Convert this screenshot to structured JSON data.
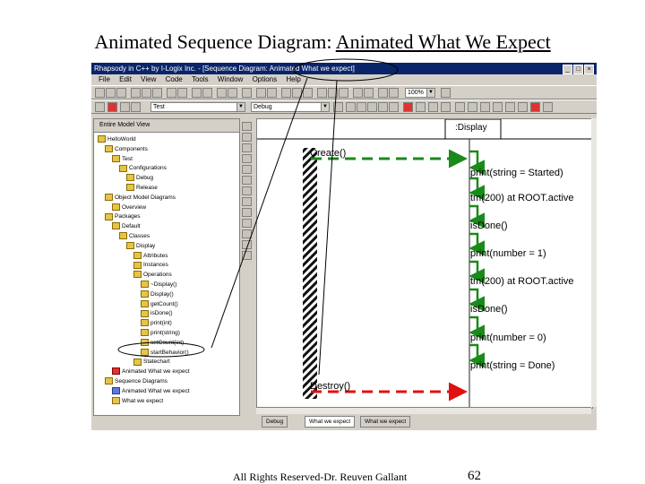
{
  "slide": {
    "title_prefix": "Animated Sequence Diagram: ",
    "title_underlined": "Animated What We Expect",
    "footer": "All Rights Reserved-Dr. Reuven Gallant",
    "page_number": "62"
  },
  "window": {
    "title": "Rhapsody in C++ by I-Logix Inc. - [Sequence Diagram: Animated What we expect]",
    "controls": [
      "_",
      "□",
      "×"
    ]
  },
  "menu": [
    "File",
    "Edit",
    "View",
    "Code",
    "Tools",
    "Window",
    "Options",
    "Help"
  ],
  "toolbar": {
    "zoom_value": "100%",
    "config_value": "Test",
    "mode_value": "Debug"
  },
  "browser": {
    "header": "Entire Model View",
    "items": [
      {
        "label": "HelloWorld",
        "icon": "folder"
      },
      {
        "label": "Components",
        "icon": "folder"
      },
      {
        "label": "Test",
        "icon": "folder"
      },
      {
        "label": "Configurations",
        "icon": "folder"
      },
      {
        "label": "Debug",
        "icon": "item"
      },
      {
        "label": "Release",
        "icon": "item"
      },
      {
        "label": "Object Model Diagrams",
        "icon": "folder"
      },
      {
        "label": "Overview",
        "icon": "item"
      },
      {
        "label": "Packages",
        "icon": "folder"
      },
      {
        "label": "Default",
        "icon": "folder"
      },
      {
        "label": "Classes",
        "icon": "folder"
      },
      {
        "label": "Display",
        "icon": "folder"
      },
      {
        "label": "Attributes",
        "icon": "folder"
      },
      {
        "label": "Instances",
        "icon": "folder"
      },
      {
        "label": "Operations",
        "icon": "folder"
      },
      {
        "label": "~Display()",
        "icon": "item"
      },
      {
        "label": "Display()",
        "icon": "item"
      },
      {
        "label": "getCount()",
        "icon": "item"
      },
      {
        "label": "isDone()",
        "icon": "item"
      },
      {
        "label": "print(int)",
        "icon": "item"
      },
      {
        "label": "print(string)",
        "icon": "item"
      },
      {
        "label": "setCount(int)",
        "icon": "item"
      },
      {
        "label": "startBehavior()",
        "icon": "item"
      },
      {
        "label": "Statechart",
        "icon": "folder"
      },
      {
        "label": "Animated What we expect",
        "icon": "red"
      },
      {
        "label": "Sequence Diagrams",
        "icon": "folder"
      },
      {
        "label": "Animated What we expect",
        "icon": "blue"
      },
      {
        "label": "What we expect",
        "icon": "item"
      }
    ]
  },
  "diagram": {
    "lifeline_label": ":Display",
    "create_label": "Create()",
    "destroy_label": "Destroy()",
    "messages": [
      "print(string = Started)",
      "tm(200) at ROOT.active",
      "isDone()",
      "print(number = 1)",
      "tm(200) at ROOT.active",
      "isDone()",
      "print(number = 0)",
      "print(string = Done)"
    ],
    "colors": {
      "message_green": "#1a8a1a",
      "destroy_red": "#e01010",
      "lifeline": "#222222"
    }
  },
  "tabs": [
    "Debug",
    "What we expect",
    "What we expect"
  ]
}
